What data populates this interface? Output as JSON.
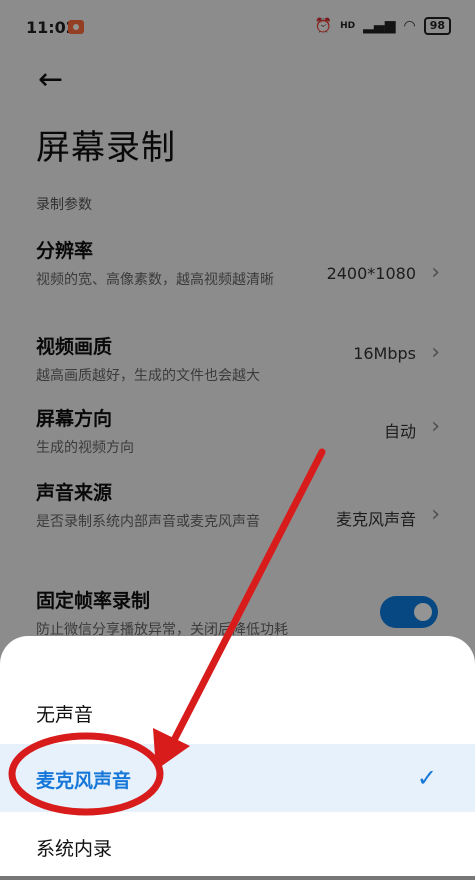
{
  "status": {
    "time": "11:02",
    "battery": "98",
    "hd": "HD"
  },
  "header": {
    "back_icon": "←",
    "title": "屏幕录制"
  },
  "section_label": "录制参数",
  "settings": [
    {
      "name": "分辨率",
      "desc": "视频的宽、高像素数，越高视频越清晰",
      "value": "2400*1080"
    },
    {
      "name": "视频画质",
      "desc": "越高画质越好，生成的文件也会越大",
      "value": "16Mbps"
    },
    {
      "name": "屏幕方向",
      "desc": "生成的视频方向",
      "value": "自动"
    },
    {
      "name": "声音来源",
      "desc": "是否录制系统内部声音或麦克风声音",
      "value": "麦克风声音"
    },
    {
      "name": "固定帧率录制",
      "desc": "防止微信分享播放异常，关闭后降低功耗",
      "toggle": true
    }
  ],
  "sheet": {
    "options": [
      {
        "label": "无声音"
      },
      {
        "label": "麦克风声音",
        "selected": true
      },
      {
        "label": "系统内录"
      }
    ],
    "check_icon": "✓"
  },
  "colors": {
    "accent": "#1677d9",
    "annotation": "#d81b1b",
    "toggle": "#0d7be0"
  }
}
